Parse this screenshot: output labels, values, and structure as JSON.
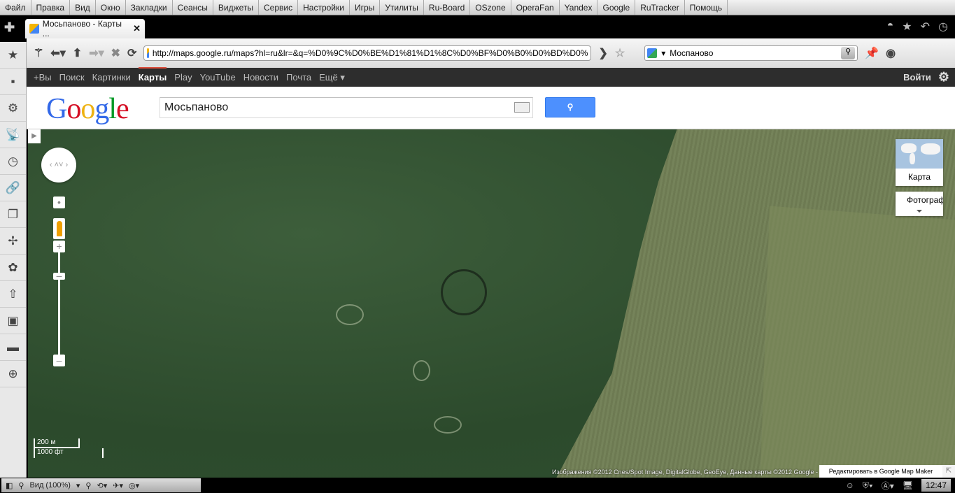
{
  "menu": [
    "Файл",
    "Правка",
    "Вид",
    "Окно",
    "Закладки",
    "Сеансы",
    "Виджеты",
    "Сервис",
    "Настройки",
    "Игры",
    "Утилиты",
    "Ru-Board",
    "OSzone",
    "OperaFan",
    "Yandex",
    "Google",
    "RuTracker",
    "Помощь"
  ],
  "tab": {
    "title": "Мосьпаново - Карты ...",
    "close": "✕"
  },
  "address": {
    "url": "http://maps.google.ru/maps?hl=ru&lr=&q=%D0%9C%D0%BE%D1%81%D1%8C%D0%BF%D0%B0%D0%BD%D0%",
    "search_value": "Моспаново"
  },
  "gbar": {
    "items": [
      "+Вы",
      "Поиск",
      "Картинки",
      "Карты",
      "Play",
      "YouTube",
      "Новости",
      "Почта",
      "Ещё ▾"
    ],
    "active_index": 3,
    "signin": "Войти"
  },
  "search": {
    "logo": "Google",
    "query": "Мосьпаново",
    "button_icon": "search-icon"
  },
  "map": {
    "map_type": "Карта",
    "photo": "Фотограф",
    "scale_metric": "200 м",
    "scale_imperial": "1000 фт",
    "attribution": "Изображения ©2012 Cnes/Spot Image, DigitalGlobe, GeoEye, Данные карты ©2012 Google -",
    "mapmaker": "Редактировать в Google Map Maker"
  },
  "status": {
    "zoom": "Вид (100%)",
    "time": "12:47"
  }
}
